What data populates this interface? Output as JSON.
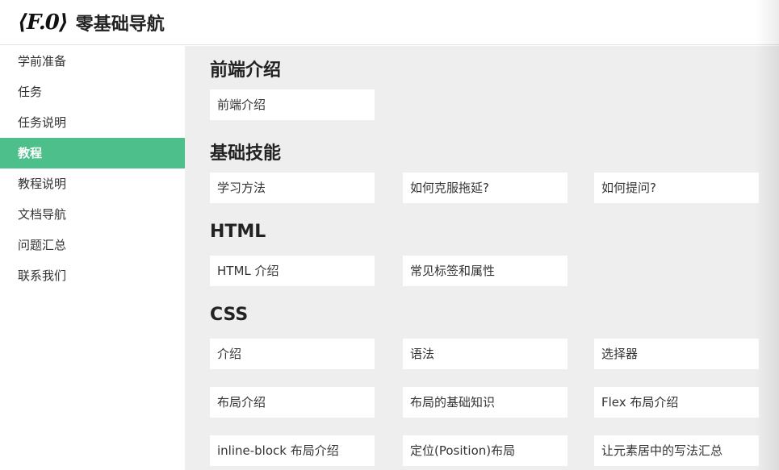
{
  "header": {
    "logo_text": "⟨F.0⟩",
    "title": "零基础导航"
  },
  "sidebar": {
    "items": [
      {
        "label": "学前准备"
      },
      {
        "label": "任务"
      },
      {
        "label": "任务说明"
      },
      {
        "label": "教程",
        "active": true
      },
      {
        "label": "教程说明"
      },
      {
        "label": "文档导航"
      },
      {
        "label": "问题汇总"
      },
      {
        "label": "联系我们"
      }
    ]
  },
  "main": {
    "sections": [
      {
        "title": "前端介绍",
        "cards": [
          "前端介绍"
        ]
      },
      {
        "title": "基础技能",
        "cards": [
          "学习方法",
          "如何克服拖延?",
          "如何提问?"
        ]
      },
      {
        "title": "HTML",
        "cards": [
          "HTML 介绍",
          "常见标签和属性"
        ]
      },
      {
        "title": "CSS",
        "cards": [
          "介绍",
          "语法",
          "选择器",
          "布局介绍",
          "布局的基础知识",
          "Flex 布局介绍",
          "inline-block 布局介绍",
          "定位(Position)布局",
          "让元素居中的写法汇总"
        ]
      }
    ]
  },
  "colors": {
    "accent": "#4cbf8a",
    "main_bg": "#eeeeee"
  }
}
